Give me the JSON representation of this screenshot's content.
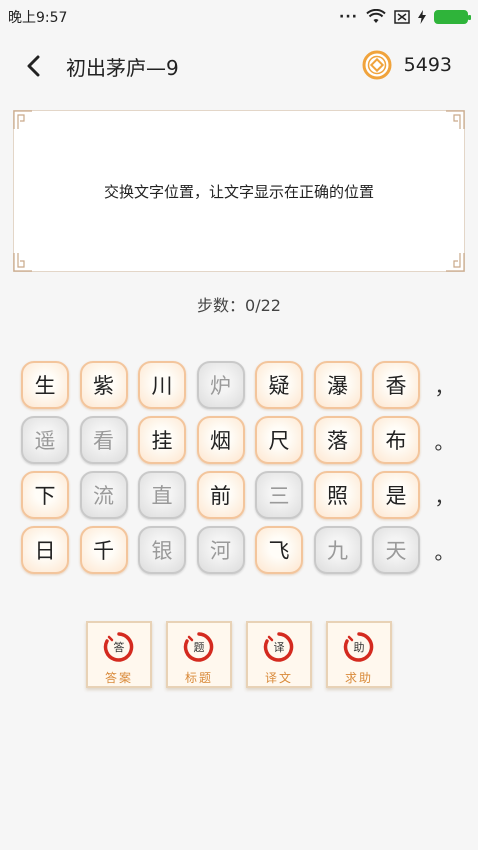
{
  "status": {
    "time": "晚上9:57"
  },
  "header": {
    "title": "初出茅庐—9",
    "coins": "5493"
  },
  "panel": {
    "instruction": "交换文字位置，让文字显示在正确的位置"
  },
  "steps": "步数：0/22",
  "grid": [
    {
      "tiles": [
        {
          "ch": "生",
          "state": "active"
        },
        {
          "ch": "紫",
          "state": "active"
        },
        {
          "ch": "川",
          "state": "active"
        },
        {
          "ch": "炉",
          "state": "fixed"
        },
        {
          "ch": "疑",
          "state": "active"
        },
        {
          "ch": "瀑",
          "state": "active"
        },
        {
          "ch": "香",
          "state": "active"
        }
      ],
      "punct": "，"
    },
    {
      "tiles": [
        {
          "ch": "遥",
          "state": "fixed"
        },
        {
          "ch": "看",
          "state": "fixed"
        },
        {
          "ch": "挂",
          "state": "active"
        },
        {
          "ch": "烟",
          "state": "active"
        },
        {
          "ch": "尺",
          "state": "active"
        },
        {
          "ch": "落",
          "state": "active"
        },
        {
          "ch": "布",
          "state": "active"
        }
      ],
      "punct": "。"
    },
    {
      "tiles": [
        {
          "ch": "下",
          "state": "active"
        },
        {
          "ch": "流",
          "state": "fixed"
        },
        {
          "ch": "直",
          "state": "fixed"
        },
        {
          "ch": "前",
          "state": "active"
        },
        {
          "ch": "三",
          "state": "fixed"
        },
        {
          "ch": "照",
          "state": "active"
        },
        {
          "ch": "是",
          "state": "active"
        }
      ],
      "punct": "，"
    },
    {
      "tiles": [
        {
          "ch": "日",
          "state": "active"
        },
        {
          "ch": "千",
          "state": "active"
        },
        {
          "ch": "银",
          "state": "fixed"
        },
        {
          "ch": "河",
          "state": "fixed"
        },
        {
          "ch": "飞",
          "state": "active"
        },
        {
          "ch": "九",
          "state": "fixed"
        },
        {
          "ch": "天",
          "state": "fixed"
        }
      ],
      "punct": "。"
    }
  ],
  "actions": [
    {
      "seal": "答",
      "label": "答案"
    },
    {
      "seal": "题",
      "label": "标题"
    },
    {
      "seal": "译",
      "label": "译文"
    },
    {
      "seal": "助",
      "label": "求助"
    }
  ],
  "colors": {
    "accent": "#d98a3a",
    "coin": "#f0a33c",
    "seal": "#d42a1f"
  },
  "icons": {
    "back": "chevron-left-icon",
    "coin": "coin-icon",
    "wifi": "wifi-icon",
    "battery": "battery-icon"
  }
}
